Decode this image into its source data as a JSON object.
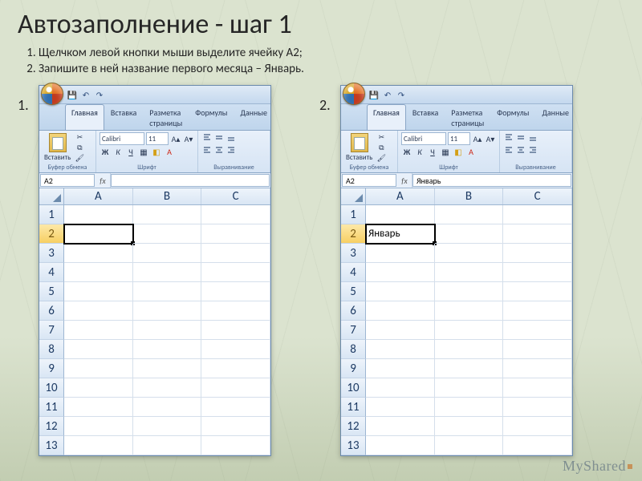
{
  "title": "Автозаполнение - шаг 1",
  "instructions": [
    "Щелчком левой кнопки мыши выделите ячейку А2;",
    "Запишите в ней название первого месяца – Январь."
  ],
  "shot_labels": {
    "left": "1.",
    "right": "2."
  },
  "ribbon": {
    "tabs": [
      "Главная",
      "Вставка",
      "Разметка страницы",
      "Формулы",
      "Данные"
    ],
    "active_tab": "Главная",
    "paste_label": "Вставить",
    "font_name": "Calibri",
    "font_size": "11",
    "group_clipboard": "Буфер обмена",
    "group_font": "Шрифт",
    "group_align": "Выравнивание",
    "bold": "Ж",
    "italic": "К",
    "underline": "Ч"
  },
  "sheet": {
    "columns": [
      "A",
      "B",
      "C"
    ],
    "row_count": 13,
    "selected_row": 2,
    "namebox": "A2"
  },
  "shots": {
    "left": {
      "formula": "",
      "a2_value": ""
    },
    "right": {
      "formula": "Январь",
      "a2_value": "Январь"
    }
  },
  "watermark": "MyShared"
}
